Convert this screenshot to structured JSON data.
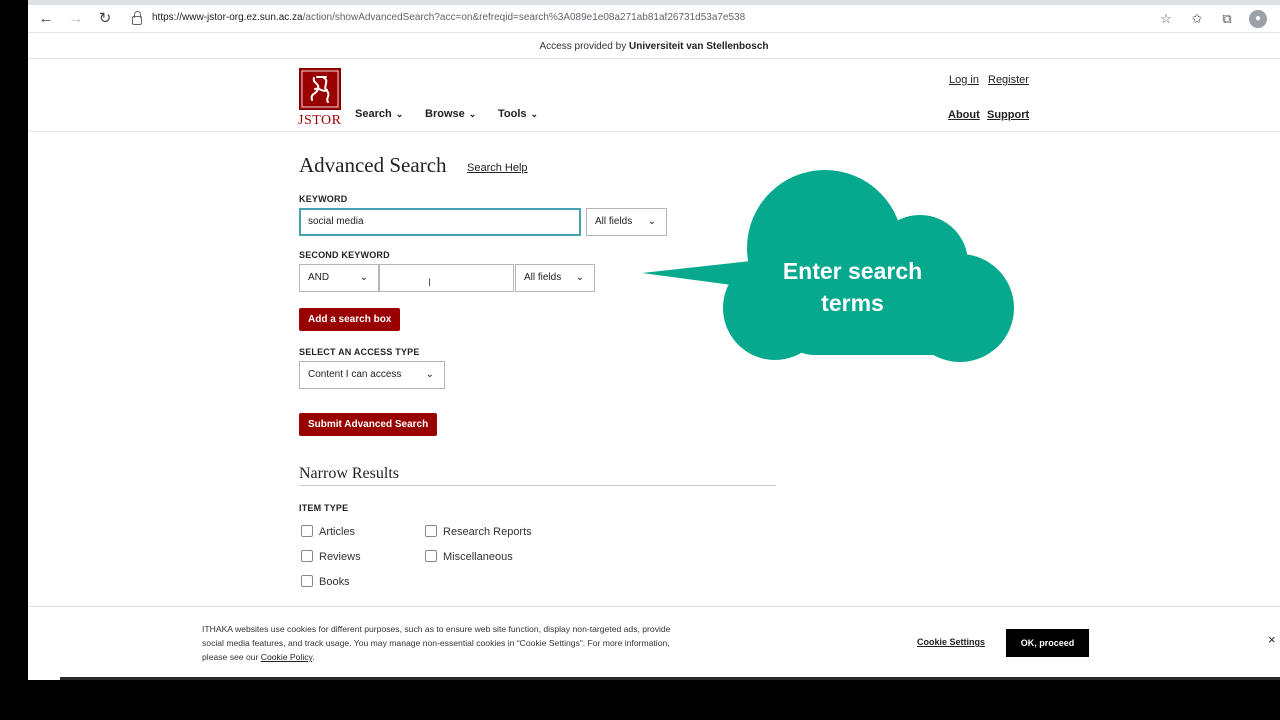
{
  "browser": {
    "url_host": "https://www-jstor-org.ez.sun.ac.za",
    "url_path": "/action/showAdvancedSearch?acc=on&refreqid=search%3A089e1e08a271ab81af26731d53a7e538",
    "icons": [
      "back-arrow-icon",
      "forward-arrow-icon",
      "reload-icon",
      "lock-icon",
      "add-favorite-icon",
      "favorites-icon",
      "collections-icon",
      "profile-icon"
    ]
  },
  "access_bar": {
    "prefix": "Access provided by",
    "institution": "Universiteit van Stellenbosch"
  },
  "header": {
    "logo_word": "JSTOR",
    "nav": [
      {
        "label": "Search"
      },
      {
        "label": "Browse"
      },
      {
        "label": "Tools"
      }
    ],
    "login": "Log in",
    "register": "Register",
    "about": "About",
    "support": "Support"
  },
  "advanced_search": {
    "title": "Advanced Search",
    "help_link": "Search Help",
    "keyword_label": "KEYWORD",
    "keyword_value": "social media",
    "keyword_field": "All fields",
    "second_keyword_label": "SECOND KEYWORD",
    "operator": "AND",
    "second_keyword_value": "",
    "second_keyword_field": "All fields",
    "add_box_button": "Add a search box",
    "access_type_label": "SELECT AN ACCESS TYPE",
    "access_type_value": "Content I can access",
    "submit_button": "Submit Advanced Search"
  },
  "narrow": {
    "title": "Narrow Results",
    "item_type_label": "ITEM TYPE",
    "items": [
      {
        "label": "Articles",
        "checked": false
      },
      {
        "label": "Research Reports",
        "checked": false
      },
      {
        "label": "Reviews",
        "checked": false
      },
      {
        "label": "Miscellaneous",
        "checked": false
      },
      {
        "label": "Books",
        "checked": false
      }
    ]
  },
  "callout": {
    "line1": "Enter search",
    "line2": "terms",
    "color": "#06A98E"
  },
  "cookie": {
    "text_1": "ITHAKA websites use cookies for different purposes, such as to ensure web site function, display non-targeted ads, provide",
    "text_2": "social media features, and track usage. You may manage non-essential cookies in “Cookie Settings”. For more information,",
    "text_3": "please see our",
    "policy_link": "Cookie Policy",
    "settings_link": "Cookie Settings",
    "ok_button": "OK, proceed",
    "close": "×"
  },
  "colors": {
    "jstor_red": "#990000",
    "focus_border": "#4A9FB5"
  }
}
